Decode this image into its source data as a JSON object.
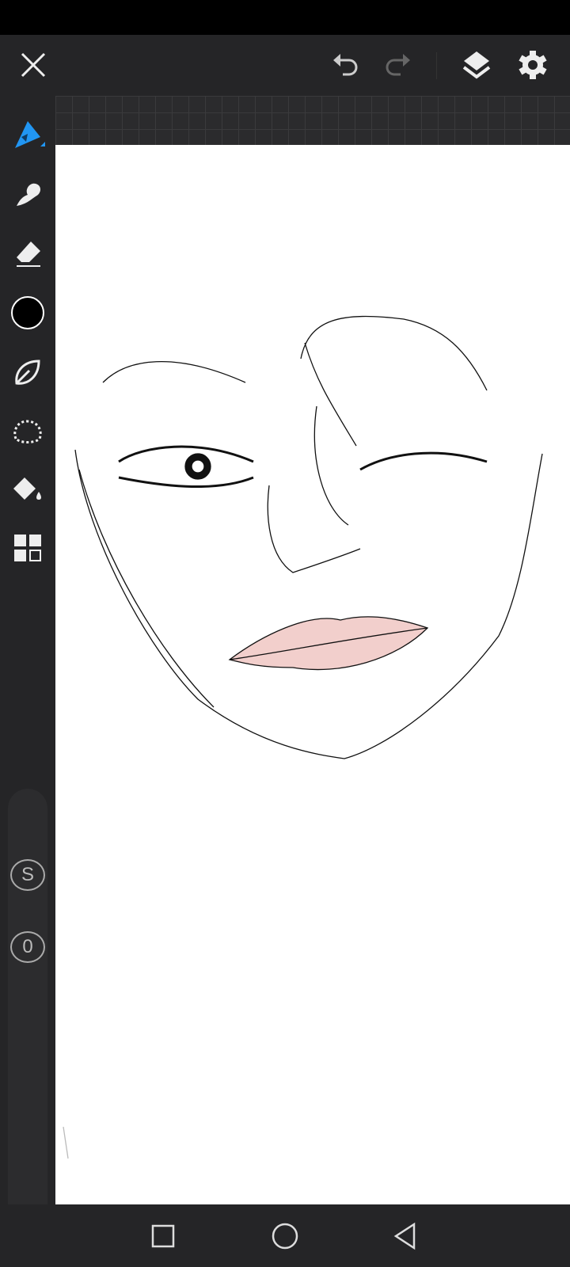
{
  "toolbar": {
    "close": "close-icon",
    "undo": "undo-icon",
    "redo": "redo-icon",
    "layers": "layers-icon",
    "settings": "gear-icon"
  },
  "tools": [
    {
      "name": "brush",
      "active": true
    },
    {
      "name": "smudge"
    },
    {
      "name": "eraser"
    },
    {
      "name": "color",
      "color": "#000000"
    },
    {
      "name": "lasso-leaf"
    },
    {
      "name": "selection"
    },
    {
      "name": "fill"
    },
    {
      "name": "apps"
    }
  ],
  "sidebar": {
    "size_label": "S",
    "opacity_label": "0"
  },
  "accent": "#2196f3"
}
